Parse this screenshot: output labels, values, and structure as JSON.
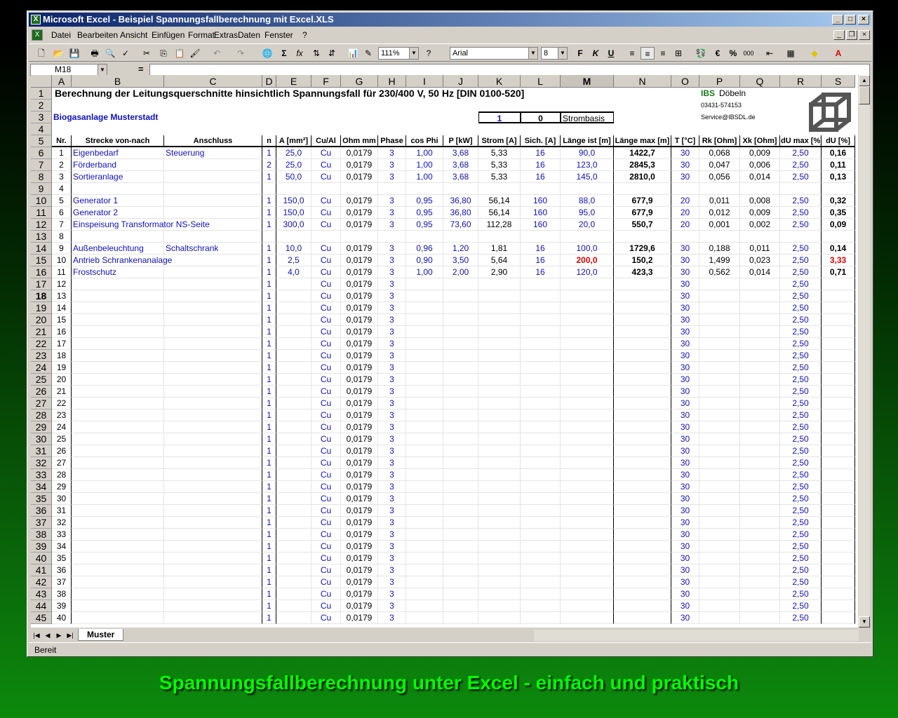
{
  "window": {
    "title": "Microsoft Excel - Beispiel Spannungsfallberechnung mit Excel.XLS"
  },
  "menu": [
    "Datei",
    "Bearbeiten",
    "Ansicht",
    "Einfügen",
    "Format",
    "Extras",
    "Daten",
    "Fenster",
    "?"
  ],
  "toolbar": {
    "zoom": "111%",
    "font": "Arial",
    "size": "8",
    "bold": "F",
    "italic": "K",
    "underline": "U"
  },
  "namebox": "M18",
  "formula": "=",
  "columns": [
    "A",
    "B",
    "C",
    "D",
    "E",
    "F",
    "G",
    "H",
    "I",
    "J",
    "K",
    "L",
    "M",
    "N",
    "O",
    "P",
    "Q",
    "R",
    "S"
  ],
  "sheet": {
    "title": "Berechnung der Leitungsquerschnitte hinsichtlich Spannungsfall für 230/400 V, 50 Hz [DIN 0100-520]",
    "ibs": "IBS",
    "ibs_city": "Döbeln",
    "phone": "03431-574153",
    "email": "Service@IBSDL.de",
    "project": "Biogasanlage Musterstadt",
    "k3": "1",
    "l3": "0",
    "strombasis": "Strombasis",
    "headers": [
      "Nr.",
      "Strecke von-nach",
      "Anschluss",
      "n",
      "A [mm²]",
      "Cu/Al",
      "Ohm mm",
      "Phase",
      "cos Phi",
      "P [kW]",
      "Strom [A]",
      "Sich. [A]",
      "Länge ist [m]",
      "Länge max [m]",
      "T [°C]",
      "Rk [Ohm]",
      "Xk [Ohm]",
      "dU max [%]",
      "dU [%]"
    ],
    "rows": [
      [
        "1",
        "Eigenbedarf",
        "Steuerung",
        "1",
        "25,0",
        "Cu",
        "0,0179",
        "3",
        "1,00",
        "3,68",
        "5,33",
        "16",
        "90,0",
        "1422,7",
        "30",
        "0,068",
        "0,009",
        "2,50",
        "0,16"
      ],
      [
        "2",
        "Förderband",
        "",
        "2",
        "25,0",
        "Cu",
        "0,0179",
        "3",
        "1,00",
        "3,68",
        "5,33",
        "16",
        "123,0",
        "2845,3",
        "30",
        "0,047",
        "0,006",
        "2,50",
        "0,11"
      ],
      [
        "3",
        "Sortieranlage",
        "",
        "1",
        "50,0",
        "Cu",
        "0,0179",
        "3",
        "1,00",
        "3,68",
        "5,33",
        "16",
        "145,0",
        "2810,0",
        "30",
        "0,056",
        "0,014",
        "2,50",
        "0,13"
      ],
      [
        "4",
        "",
        "",
        "",
        "",
        "",
        "",
        "",
        "",
        "",
        "",
        "",
        "",
        "",
        "",
        "",
        "",
        "",
        ""
      ],
      [
        "5",
        "Generator 1",
        "",
        "1",
        "150,0",
        "Cu",
        "0,0179",
        "3",
        "0,95",
        "36,80",
        "56,14",
        "160",
        "88,0",
        "677,9",
        "20",
        "0,011",
        "0,008",
        "2,50",
        "0,32"
      ],
      [
        "6",
        "Generator 2",
        "",
        "1",
        "150,0",
        "Cu",
        "0,0179",
        "3",
        "0,95",
        "36,80",
        "56,14",
        "160",
        "95,0",
        "677,9",
        "20",
        "0,012",
        "0,009",
        "2,50",
        "0,35"
      ],
      [
        "7",
        "Einspeisung Transformator NS-Seite",
        "",
        "1",
        "300,0",
        "Cu",
        "0,0179",
        "3",
        "0,95",
        "73,60",
        "112,28",
        "160",
        "20,0",
        "550,7",
        "20",
        "0,001",
        "0,002",
        "2,50",
        "0,09"
      ],
      [
        "8",
        "",
        "",
        "",
        "",
        "",
        "",
        "",
        "",
        "",
        "",
        "",
        "",
        "",
        "",
        "",
        "",
        "",
        ""
      ],
      [
        "9",
        "Außenbeleuchtung",
        "Schaltschrank",
        "1",
        "10,0",
        "Cu",
        "0,0179",
        "3",
        "0,96",
        "1,20",
        "1,81",
        "16",
        "100,0",
        "1729,6",
        "30",
        "0,188",
        "0,011",
        "2,50",
        "0,14"
      ],
      [
        "10",
        "Antrieb Schrankenanalage",
        "",
        "1",
        "2,5",
        "Cu",
        "0,0179",
        "3",
        "0,90",
        "3,50",
        "5,64",
        "16",
        "200,0",
        "150,2",
        "30",
        "1,499",
        "0,023",
        "2,50",
        "3,33"
      ],
      [
        "11",
        "Frostschutz",
        "",
        "1",
        "4,0",
        "Cu",
        "0,0179",
        "3",
        "1,00",
        "2,00",
        "2,90",
        "16",
        "120,0",
        "423,3",
        "30",
        "0,562",
        "0,014",
        "2,50",
        "0,71"
      ]
    ],
    "empty_rows": [
      "12",
      "13",
      "14",
      "15",
      "16",
      "17",
      "18",
      "19",
      "20",
      "21",
      "22",
      "23",
      "24",
      "25",
      "26",
      "27",
      "28",
      "29",
      "30",
      "31",
      "32",
      "33",
      "34",
      "35",
      "36",
      "37",
      "38",
      "39",
      "40"
    ],
    "empty_defaults": {
      "n": "1",
      "cu": "Cu",
      "ohm": "0,0179",
      "phase": "3",
      "t": "30",
      "dumax": "2,50"
    }
  },
  "sheet_tab": "Muster",
  "status": "Bereit",
  "caption": "Spannungsfallberechnung unter Excel - einfach und praktisch",
  "colors": {
    "blue_text": "#1010c0",
    "red_text": "#e00000",
    "caption": "#00ff00",
    "title_bar": "#0a246a"
  }
}
